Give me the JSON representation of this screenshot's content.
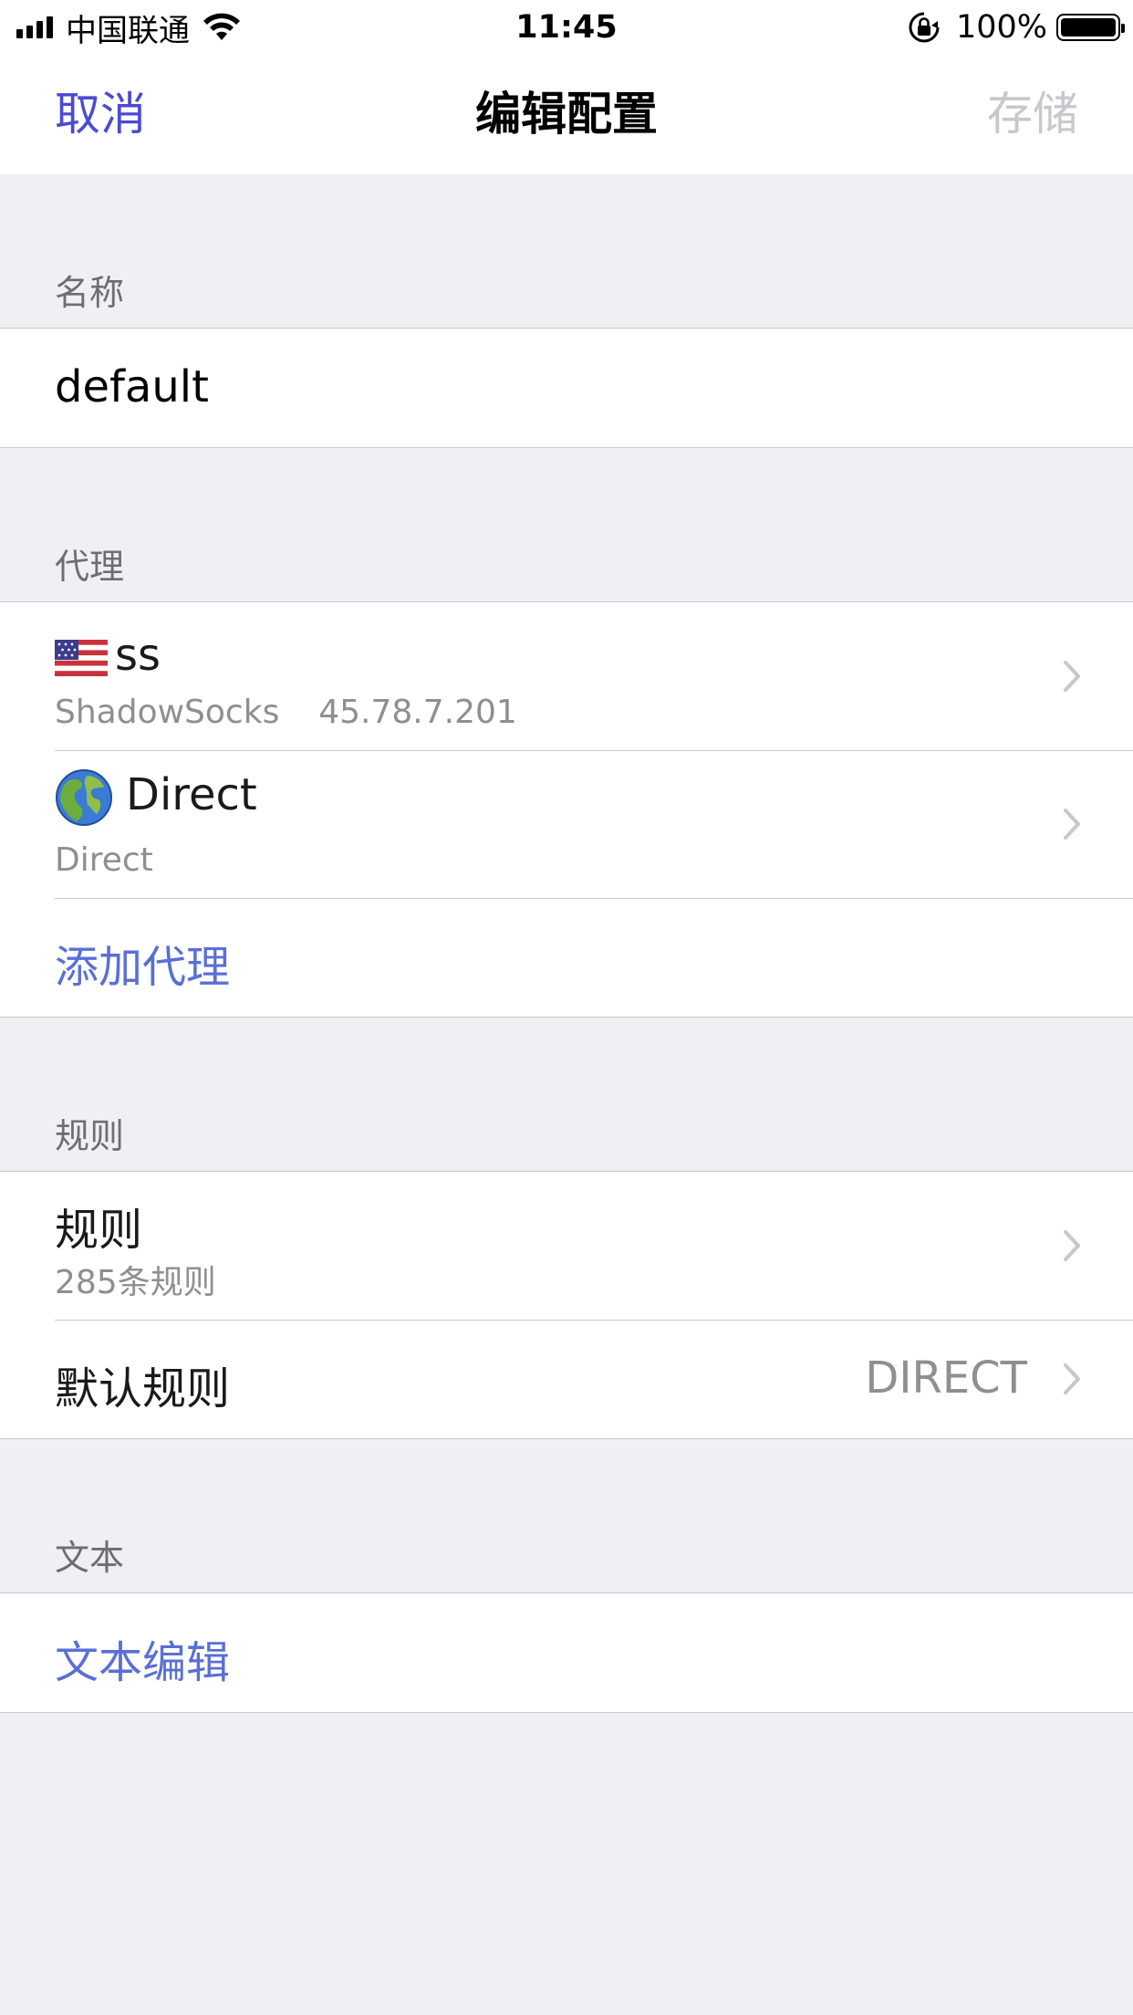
{
  "status_bar": {
    "carrier": "中国联通",
    "time": "11:45",
    "battery_percent": "100%",
    "battery_level": 1.0,
    "icons": [
      "signal-icon",
      "wifi-icon",
      "rotation-lock-icon",
      "battery-icon"
    ]
  },
  "nav": {
    "cancel_label": "取消",
    "title": "编辑配置",
    "save_label": "存储"
  },
  "sections": {
    "name": {
      "header": "名称",
      "value": "default"
    },
    "proxy": {
      "header": "代理",
      "items": [
        {
          "icon": "us-flag-icon",
          "title": "ss",
          "type": "ShadowSocks",
          "address": "45.78.7.201"
        },
        {
          "icon": "globe-icon",
          "title": "Direct",
          "subtitle": "Direct"
        }
      ],
      "add_label": "添加代理"
    },
    "rules": {
      "header": "规则",
      "rules_title": "规则",
      "rules_count": "285条规则",
      "default_rule_label": "默认规则",
      "default_rule_value": "DIRECT"
    },
    "text": {
      "header": "文本",
      "edit_label": "文本编辑"
    }
  },
  "colors": {
    "background": "#efeff4",
    "link": "#5a6fd6",
    "nav_cancel": "#4a4ad2",
    "disabled": "#c8c8cc",
    "secondary_text": "#8e8e93"
  }
}
